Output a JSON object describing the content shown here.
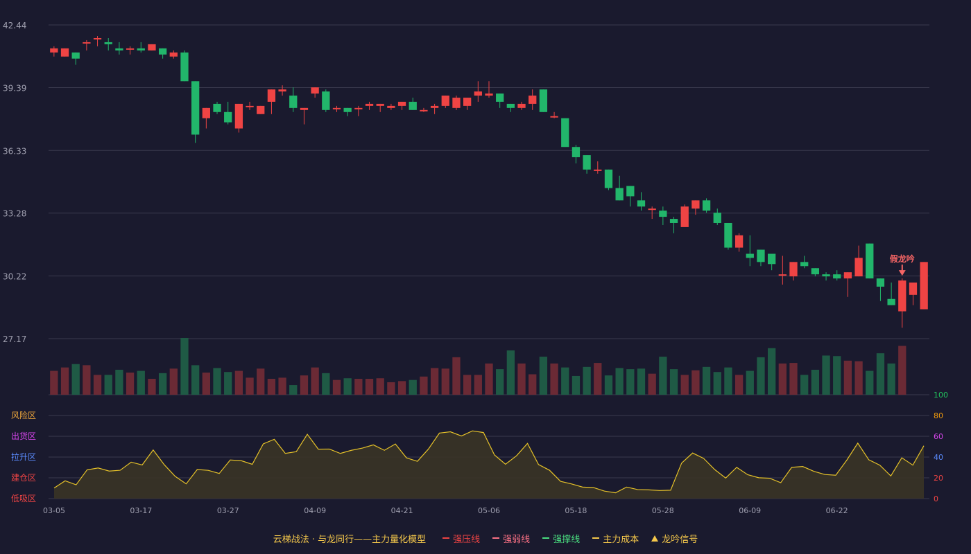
{
  "chart_data": {
    "type": "candlestick",
    "price_axis": {
      "ticks": [
        "42.44",
        "39.39",
        "36.33",
        "33.28",
        "30.22",
        "27.17"
      ],
      "ylim": [
        27.17,
        42.44
      ]
    },
    "indicator_axis": {
      "ticks": [
        "100",
        "80",
        "60",
        "40",
        "20",
        "0"
      ],
      "ylim": [
        0,
        100
      ],
      "zone_labels": [
        "风险区",
        "出货区",
        "拉升区",
        "建仓区",
        "低吸区"
      ],
      "zone_colors": [
        "#e8a33b",
        "#d946ef",
        "#5b8cff",
        "#ef4444",
        "#ef4444"
      ],
      "tick_colors": [
        "#22c55e",
        "#f59e0b",
        "#d946ef",
        "#5b8cff",
        "#ef4444",
        "#ef4444"
      ]
    },
    "x_ticks": [
      "03-05",
      "03-17",
      "03-27",
      "04-09",
      "04-21",
      "05-06",
      "05-18",
      "05-28",
      "06-09",
      "06-22"
    ],
    "x_tick_indices": [
      0,
      8,
      16,
      24,
      32,
      40,
      48,
      56,
      64,
      72
    ],
    "candles": [
      [
        41.1,
        41.3,
        41.0,
        41.4,
        40.9
      ],
      [
        40.9,
        41.3,
        41.3,
        41.3,
        40.9
      ],
      [
        41.1,
        40.8,
        41.1,
        41.1,
        40.5
      ],
      [
        41.6,
        41.6,
        41.4,
        41.7,
        41.2
      ],
      [
        41.8,
        41.8,
        41.7,
        41.9,
        41.4
      ],
      [
        41.6,
        41.5,
        41.6,
        41.8,
        41.2
      ],
      [
        41.3,
        41.2,
        41.3,
        41.6,
        41.0
      ],
      [
        41.3,
        41.3,
        41.3,
        41.4,
        41.0
      ],
      [
        41.3,
        41.2,
        41.3,
        41.6,
        41.1
      ],
      [
        41.2,
        41.5,
        41.2,
        41.5,
        41.2
      ],
      [
        41.3,
        41.0,
        41.3,
        41.3,
        40.8
      ],
      [
        40.9,
        41.1,
        41.1,
        41.2,
        40.8
      ],
      [
        41.1,
        39.7,
        41.1,
        41.2,
        39.7
      ],
      [
        39.7,
        37.1,
        39.7,
        39.7,
        36.7
      ],
      [
        37.9,
        38.4,
        37.9,
        38.4,
        37.4
      ],
      [
        38.6,
        38.2,
        38.6,
        38.7,
        38.1
      ],
      [
        38.2,
        37.7,
        38.2,
        38.7,
        37.6
      ],
      [
        37.4,
        38.6,
        37.4,
        38.6,
        37.2
      ],
      [
        38.5,
        38.5,
        38.5,
        38.7,
        38.3
      ],
      [
        38.1,
        38.5,
        38.1,
        38.5,
        38.1
      ],
      [
        38.7,
        39.3,
        38.7,
        39.3,
        38.1
      ],
      [
        39.2,
        39.3,
        39.2,
        39.5,
        39.0
      ],
      [
        39.0,
        38.4,
        39.0,
        39.4,
        38.2
      ],
      [
        38.3,
        38.4,
        38.3,
        38.4,
        37.6
      ],
      [
        39.1,
        39.4,
        39.1,
        39.4,
        38.9
      ],
      [
        39.2,
        38.3,
        39.2,
        39.3,
        38.2
      ],
      [
        38.4,
        38.4,
        38.4,
        38.5,
        38.2
      ],
      [
        38.4,
        38.2,
        38.4,
        38.4,
        38.0
      ],
      [
        38.4,
        38.4,
        38.4,
        38.5,
        38.0
      ],
      [
        38.5,
        38.6,
        38.5,
        38.7,
        38.3
      ],
      [
        38.5,
        38.6,
        38.6,
        38.6,
        38.2
      ],
      [
        38.4,
        38.5,
        38.4,
        38.6,
        38.3
      ],
      [
        38.5,
        38.7,
        38.5,
        38.7,
        38.3
      ],
      [
        38.7,
        38.3,
        38.7,
        38.9,
        38.3
      ],
      [
        38.3,
        38.3,
        38.3,
        38.4,
        38.2
      ],
      [
        38.4,
        38.5,
        38.4,
        38.6,
        38.1
      ],
      [
        38.5,
        39.0,
        38.5,
        39.0,
        38.4
      ],
      [
        38.4,
        38.9,
        38.4,
        39.0,
        38.3
      ],
      [
        38.5,
        38.9,
        38.5,
        38.9,
        38.3
      ],
      [
        39.0,
        39.2,
        39.0,
        39.7,
        38.7
      ],
      [
        39.0,
        39.1,
        39.1,
        39.7,
        38.9
      ],
      [
        39.1,
        38.7,
        39.1,
        39.1,
        38.4
      ],
      [
        38.6,
        38.4,
        38.6,
        38.6,
        38.2
      ],
      [
        38.4,
        38.6,
        38.4,
        38.7,
        38.3
      ],
      [
        38.6,
        39.0,
        38.6,
        39.3,
        38.3
      ],
      [
        39.3,
        38.2,
        39.3,
        39.3,
        38.2
      ],
      [
        38.0,
        38.0,
        38.0,
        38.2,
        37.9
      ],
      [
        37.9,
        36.5,
        37.9,
        37.9,
        36.5
      ],
      [
        36.5,
        36.0,
        36.5,
        36.6,
        35.7
      ],
      [
        36.1,
        35.4,
        36.1,
        36.1,
        35.2
      ],
      [
        35.4,
        35.4,
        35.4,
        35.8,
        35.2
      ],
      [
        35.4,
        34.5,
        35.4,
        35.4,
        34.4
      ],
      [
        34.5,
        33.9,
        34.5,
        35.1,
        33.9
      ],
      [
        34.6,
        34.1,
        34.6,
        34.6,
        33.6
      ],
      [
        33.9,
        33.6,
        33.9,
        34.3,
        33.4
      ],
      [
        33.5,
        33.5,
        33.5,
        33.6,
        33.0
      ],
      [
        33.4,
        33.1,
        33.4,
        33.6,
        32.7
      ],
      [
        33.0,
        32.8,
        33.0,
        33.1,
        32.3
      ],
      [
        32.6,
        33.6,
        32.6,
        33.7,
        32.6
      ],
      [
        33.5,
        33.9,
        33.5,
        33.9,
        33.2
      ],
      [
        33.9,
        33.4,
        33.9,
        34.0,
        33.3
      ],
      [
        33.3,
        32.8,
        33.3,
        33.5,
        32.7
      ],
      [
        32.8,
        31.6,
        32.8,
        32.8,
        31.5
      ],
      [
        31.6,
        32.2,
        31.6,
        32.3,
        31.4
      ],
      [
        31.3,
        31.1,
        31.3,
        32.2,
        30.7
      ],
      [
        31.5,
        30.9,
        31.5,
        31.5,
        30.7
      ],
      [
        31.3,
        30.8,
        31.3,
        31.3,
        30.5
      ],
      [
        30.3,
        30.3,
        30.3,
        31.2,
        29.8
      ],
      [
        30.2,
        30.9,
        30.2,
        30.9,
        30.0
      ],
      [
        30.9,
        30.7,
        30.9,
        31.2,
        30.6
      ],
      [
        30.6,
        30.3,
        30.6,
        30.6,
        30.2
      ],
      [
        30.3,
        30.2,
        30.3,
        30.4,
        30.0
      ],
      [
        30.3,
        30.1,
        30.3,
        30.5,
        30.0
      ],
      [
        30.1,
        30.4,
        30.1,
        30.4,
        29.2
      ],
      [
        30.2,
        31.1,
        30.2,
        31.7,
        30.2
      ],
      [
        31.8,
        30.1,
        31.8,
        31.8,
        30.1
      ],
      [
        30.1,
        29.7,
        30.1,
        30.1,
        29.0
      ],
      [
        29.1,
        28.8,
        29.1,
        29.9,
        28.8
      ],
      [
        28.5,
        30.0,
        28.5,
        30.1,
        27.7
      ],
      [
        29.3,
        29.9,
        29.9,
        29.9,
        28.8
      ],
      [
        28.6,
        30.9,
        28.6,
        30.9,
        28.6
      ]
    ],
    "volume_ratio": [
      0.42,
      0.48,
      0.54,
      0.52,
      0.35,
      0.35,
      0.44,
      0.39,
      0.42,
      0.28,
      0.38,
      0.46,
      1.0,
      0.52,
      0.39,
      0.47,
      0.4,
      0.42,
      0.3,
      0.46,
      0.28,
      0.3,
      0.17,
      0.34,
      0.48,
      0.38,
      0.26,
      0.29,
      0.28,
      0.28,
      0.29,
      0.22,
      0.24,
      0.26,
      0.32,
      0.47,
      0.46,
      0.66,
      0.35,
      0.35,
      0.55,
      0.45,
      0.78,
      0.55,
      0.36,
      0.67,
      0.55,
      0.48,
      0.33,
      0.49,
      0.56,
      0.34,
      0.47,
      0.45,
      0.46,
      0.37,
      0.67,
      0.45,
      0.35,
      0.43,
      0.49,
      0.4,
      0.48,
      0.35,
      0.42,
      0.66,
      0.82,
      0.55,
      0.56,
      0.35,
      0.44,
      0.69,
      0.68,
      0.6,
      0.59,
      0.42,
      0.73,
      0.55,
      0.86
    ],
    "volume_axis_label": "100",
    "indicator": [
      10.2,
      17.1,
      13.3,
      27.7,
      29.5,
      26.5,
      27.3,
      35.1,
      32.4,
      46.8,
      32.7,
      21.4,
      14.2,
      28.0,
      27.2,
      24.2,
      37.2,
      36.5,
      33.0,
      52.7,
      57.1,
      43.5,
      45.2,
      61.9,
      47.6,
      47.7,
      43.5,
      46.5,
      48.6,
      51.7,
      46.5,
      52.6,
      39.3,
      35.9,
      47.7,
      63.1,
      64.3,
      60.3,
      65.2,
      63.6,
      42.0,
      33.1,
      41.2,
      53.1,
      32.8,
      27.3,
      16.6,
      14.1,
      11.1,
      10.6,
      7.2,
      5.6,
      11.1,
      8.7,
      8.4,
      7.8,
      8.1,
      34.2,
      43.9,
      38.7,
      28.0,
      19.8,
      30.1,
      23.0,
      20.1,
      19.6,
      15.3,
      30.1,
      30.9,
      26.3,
      23.2,
      22.5,
      37.0,
      53.4,
      37.4,
      32.2,
      21.8,
      39.3,
      32.2,
      50.9
    ],
    "signal": {
      "label": "假龙吟",
      "index": 78
    },
    "legend": {
      "title": "云梯战法 · 与龙同行——主力量化模型",
      "items": [
        {
          "label": "强压线",
          "color": "#ef4444",
          "marker": "solid"
        },
        {
          "label": "强弱线",
          "color": "#fb7185",
          "marker": "dash"
        },
        {
          "label": "强撑线",
          "color": "#4ade80",
          "marker": "solid"
        },
        {
          "label": "主力成本",
          "color": "#f5c84b",
          "marker": "dash"
        },
        {
          "label": "龙吟信号",
          "color": "#f5c84b",
          "marker": "triangle"
        }
      ]
    },
    "colors": {
      "up": "#ef4444",
      "down": "#22b66b",
      "vol_up": "#6b2a35",
      "vol_down": "#1f5a45",
      "indicator_line": "#e6c229",
      "indicator_fill": "#3a3426",
      "grid": "#3a3a4e",
      "axis_text": "#a0a0b0",
      "signal": "#f56565"
    }
  }
}
